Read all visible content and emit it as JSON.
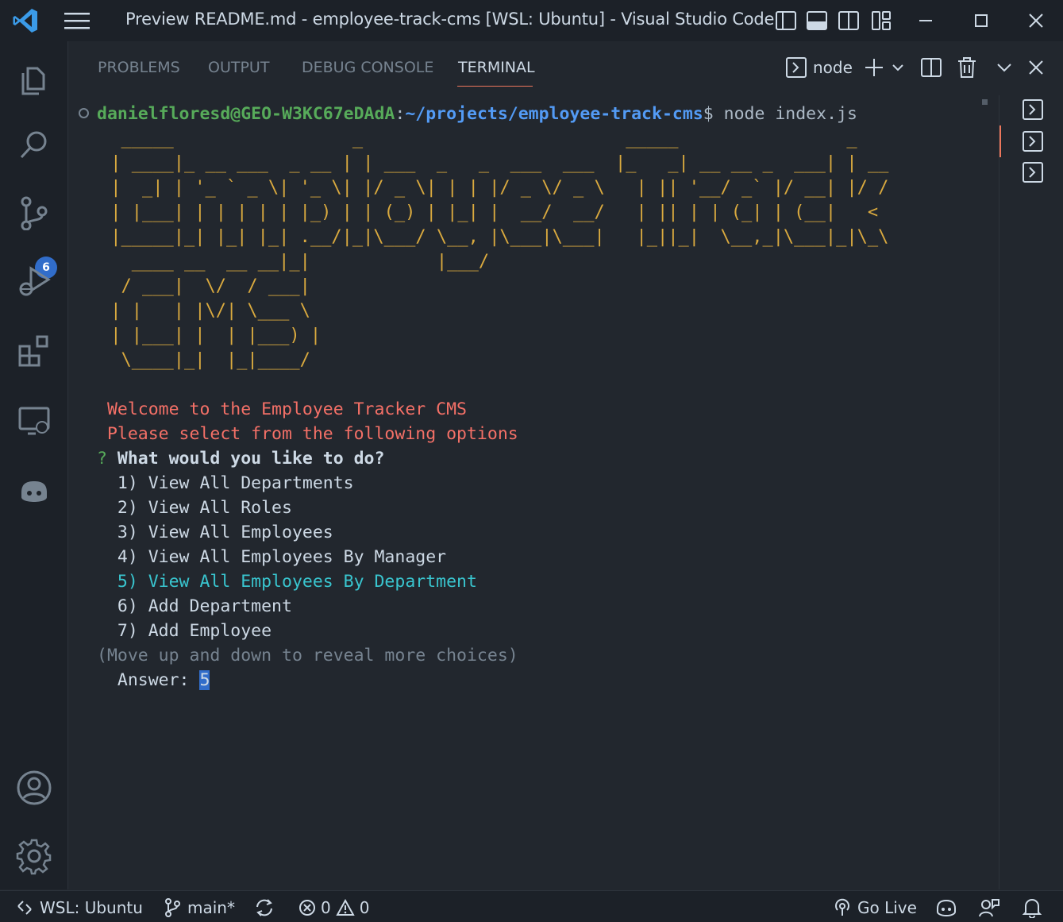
{
  "window": {
    "title": "Preview README.md - employee-track-cms [WSL: Ubuntu] - Visual Studio Code"
  },
  "activity_bar": {
    "source_control_badge": "6"
  },
  "panel": {
    "tabs": [
      {
        "label": "PROBLEMS"
      },
      {
        "label": "OUTPUT"
      },
      {
        "label": "DEBUG CONSOLE"
      },
      {
        "label": "TERMINAL"
      }
    ],
    "active_tab": "TERMINAL",
    "terminal_name": "node"
  },
  "terminal": {
    "user_host": "danielfloresd@GEO-W3KC67eDAdA",
    "colon": ":",
    "path": "~/projects/employee-track-cms",
    "prompt_symbol": "$",
    "command": " node index.js",
    "ascii_art": [
      "  _____                 _                         _____                _    ",
      " | ____|_ __ ___  _ __ | | ___  _   _  ___  ___  |_   _| __ __ _  ___| | __",
      " |  _| | '_ ` _ \\| '_ \\| |/ _ \\| | | |/ _ \\/ _ \\   | || '__/ _` |/ __| |/ /",
      " | |___| | | | | | |_) | | (_) | |_| |  __/  __/   | || | | (_| | (__|   < ",
      " |_____|_| |_| |_| .__/|_|\\___/ \\__, |\\___|\\___|   |_||_|  \\__,_|\\___|_|\\_\\",
      "   ____ __  __ __|_|            |___/                                       ",
      "  / ___|  \\/  / ___|                                                        ",
      " | |   | |\\/| \\___ \\                                                        ",
      " | |___| |  | |___) |                                                       ",
      "  \\____|_|  |_|____/                                                        "
    ],
    "welcome": " Welcome to the Employee Tracker CMS",
    "select_prompt": " Please select from the following options",
    "question_mark": "?",
    "question": " What would you like to do?",
    "choices": [
      "  1) View All Departments",
      "  2) View All Roles",
      "  3) View All Employees",
      "  4) View All Employees By Manager",
      "  5) View All Employees By Department",
      "  6) Add Department",
      "  7) Add Employee"
    ],
    "selected_index": 4,
    "hint": "(Move up and down to reveal more choices)",
    "answer_label": "  Answer: ",
    "answer_value": "5"
  },
  "statusbar": {
    "remote": "WSL: Ubuntu",
    "branch": "main*",
    "errors": "0",
    "warnings": "0",
    "go_live": "Go Live"
  },
  "colors": {
    "user": "#57ab5a",
    "path": "#539bf5",
    "ascii": "#daaa3f",
    "red_text": "#f47067",
    "selected_choice": "#39c5cf",
    "accent_tab": "#ec775c",
    "badge": "#316dca"
  }
}
